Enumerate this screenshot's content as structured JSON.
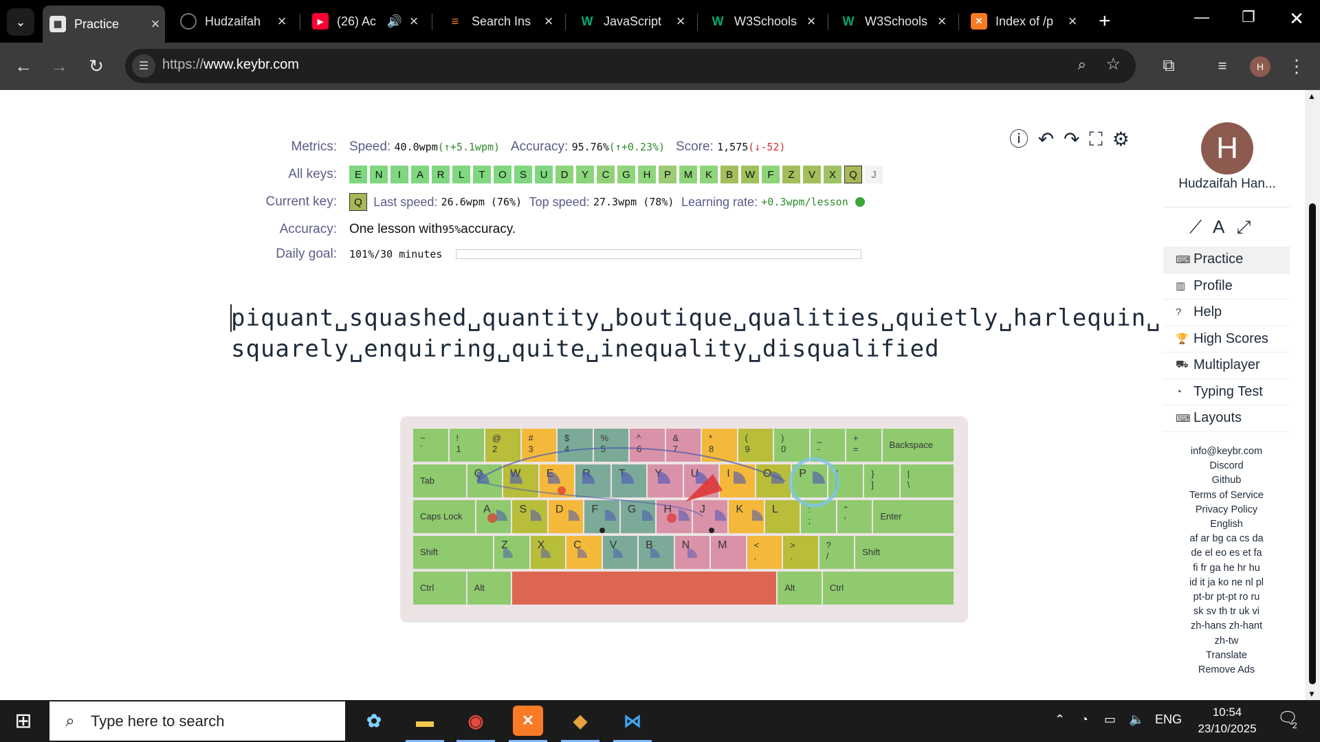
{
  "browser": {
    "tabs": [
      {
        "title": "Practice",
        "active": true,
        "favicon": "keybr-icon"
      },
      {
        "title": "Hudzaifah",
        "active": false,
        "favicon": "spinner-icon"
      },
      {
        "title": "(26) Ac",
        "active": false,
        "favicon": "youtube-icon"
      },
      {
        "title": "Search Ins",
        "active": false,
        "favicon": "stackoverflow-icon"
      },
      {
        "title": "JavaScript",
        "active": false,
        "favicon": "w3schools-icon"
      },
      {
        "title": "W3Schools",
        "active": false,
        "favicon": "w3schools-icon"
      },
      {
        "title": "W3Schools",
        "active": false,
        "favicon": "w3schools-icon"
      },
      {
        "title": "Index of /p",
        "active": false,
        "favicon": "xampp-icon"
      }
    ],
    "url_prefix": "https://",
    "url_host": "www.keybr.com",
    "profile_initial": "H"
  },
  "metrics": {
    "metrics_label": "Metrics:",
    "speed_label": "Speed:",
    "speed_value": "40.0wpm",
    "speed_delta": "(↑+5.1wpm)",
    "accuracy_label": "Accuracy:",
    "accuracy_value": "95.76%",
    "accuracy_delta": "(↑+0.23%)",
    "score_label": "Score:",
    "score_value": "1,575",
    "score_delta": "(↓-52)",
    "allkeys_label": "All keys:",
    "keys": [
      "E",
      "N",
      "I",
      "A",
      "R",
      "L",
      "T",
      "O",
      "S",
      "U",
      "D",
      "Y",
      "C",
      "G",
      "H",
      "P",
      "M",
      "K",
      "B",
      "W",
      "F",
      "Z",
      "V",
      "X",
      "Q",
      "J"
    ],
    "current_key_label": "Current key:",
    "current_key": "Q",
    "last_speed_label": "Last speed:",
    "last_speed": "26.6wpm (76%)",
    "top_speed_label": "Top speed:",
    "top_speed": "27.3wpm (78%)",
    "learning_rate_label": "Learning rate:",
    "learning_rate": "+0.3wpm/lesson",
    "accuracy_row_label": "Accuracy:",
    "accuracy_text_a": "One lesson with ",
    "accuracy_text_b": "95%",
    "accuracy_text_c": " accuracy.",
    "daily_goal_label": "Daily goal:",
    "daily_goal_value": "101%/30 minutes"
  },
  "lesson": {
    "line1": "piquant␣squashed␣quantity␣boutique␣qualities␣quietly␣harlequin␣",
    "line2": "squarely␣enquiring␣quite␣inequality␣disqualified"
  },
  "keyboard": {
    "row1": [
      [
        "~",
        "`"
      ],
      [
        "!",
        "1"
      ],
      [
        "@",
        "2"
      ],
      [
        "#",
        "3"
      ],
      [
        "$",
        "4"
      ],
      [
        "%",
        "5"
      ],
      [
        "^",
        "6"
      ],
      [
        "&",
        "7"
      ],
      [
        "*",
        "8"
      ],
      [
        "(",
        "9"
      ],
      [
        ")",
        "0"
      ],
      [
        "_",
        "-"
      ],
      [
        "+",
        "="
      ]
    ],
    "backspace": "Backspace",
    "tab": "Tab",
    "row2": [
      "Q",
      "W",
      "E",
      "R",
      "T",
      "Y",
      "U",
      "I",
      "O",
      "P"
    ],
    "row2_extra": [
      [
        "{",
        "["
      ],
      [
        "}",
        "]"
      ],
      [
        "|",
        "\\"
      ]
    ],
    "caps": "Caps Lock",
    "row3": [
      "A",
      "S",
      "D",
      "F",
      "G",
      "H",
      "J",
      "K",
      "L"
    ],
    "row3_extra": [
      [
        ":",
        ";"
      ],
      [
        "\"",
        "'"
      ]
    ],
    "enter": "Enter",
    "shift_left": "Shift",
    "row4": [
      "Z",
      "X",
      "C",
      "V",
      "B",
      "N",
      "M"
    ],
    "row4_extra": [
      [
        "<",
        ","
      ],
      [
        ">",
        "."
      ],
      [
        "?",
        "/"
      ]
    ],
    "shift_right": "Shift",
    "ctrl_left": "Ctrl",
    "alt_left": "Alt",
    "alt_right": "Alt",
    "ctrl_right": "Ctrl"
  },
  "sidebar": {
    "user_initial": "H",
    "username": "Hudzaifah Han...",
    "nav": [
      {
        "label": "Practice",
        "icon": "keyboard-icon"
      },
      {
        "label": "Profile",
        "icon": "chart-icon"
      },
      {
        "label": "Help",
        "icon": "help-icon"
      },
      {
        "label": "High Scores",
        "icon": "trophy-icon"
      },
      {
        "label": "Multiplayer",
        "icon": "car-icon"
      },
      {
        "label": "Typing Test",
        "icon": "gauge-icon"
      },
      {
        "label": "Layouts",
        "icon": "keyboard-icon"
      }
    ],
    "links": [
      "info@keybr.com",
      "Discord",
      "Github",
      "Terms of Service",
      "Privacy Policy",
      "English",
      "af ar bg ca cs da",
      "de el eo es et fa",
      "fi fr ga he hr hu",
      "id it ja ko ne nl pl",
      "pt-br pt-pt ro ru",
      "sk sv th tr uk vi",
      "zh-hans zh-hant",
      "zh-tw",
      "Translate",
      "Remove Ads"
    ]
  },
  "taskbar": {
    "search_placeholder": "Type here to search",
    "lang": "ENG",
    "time": "10:54",
    "date": "23/10/2025",
    "notifications": "2"
  },
  "colors": {
    "key_green": "#8fca6f",
    "key_olive": "#b8bd3a",
    "key_orange": "#f4b93a",
    "key_teal": "#7bab98",
    "key_pink": "#d992a8",
    "space_red": "#dd6652"
  }
}
